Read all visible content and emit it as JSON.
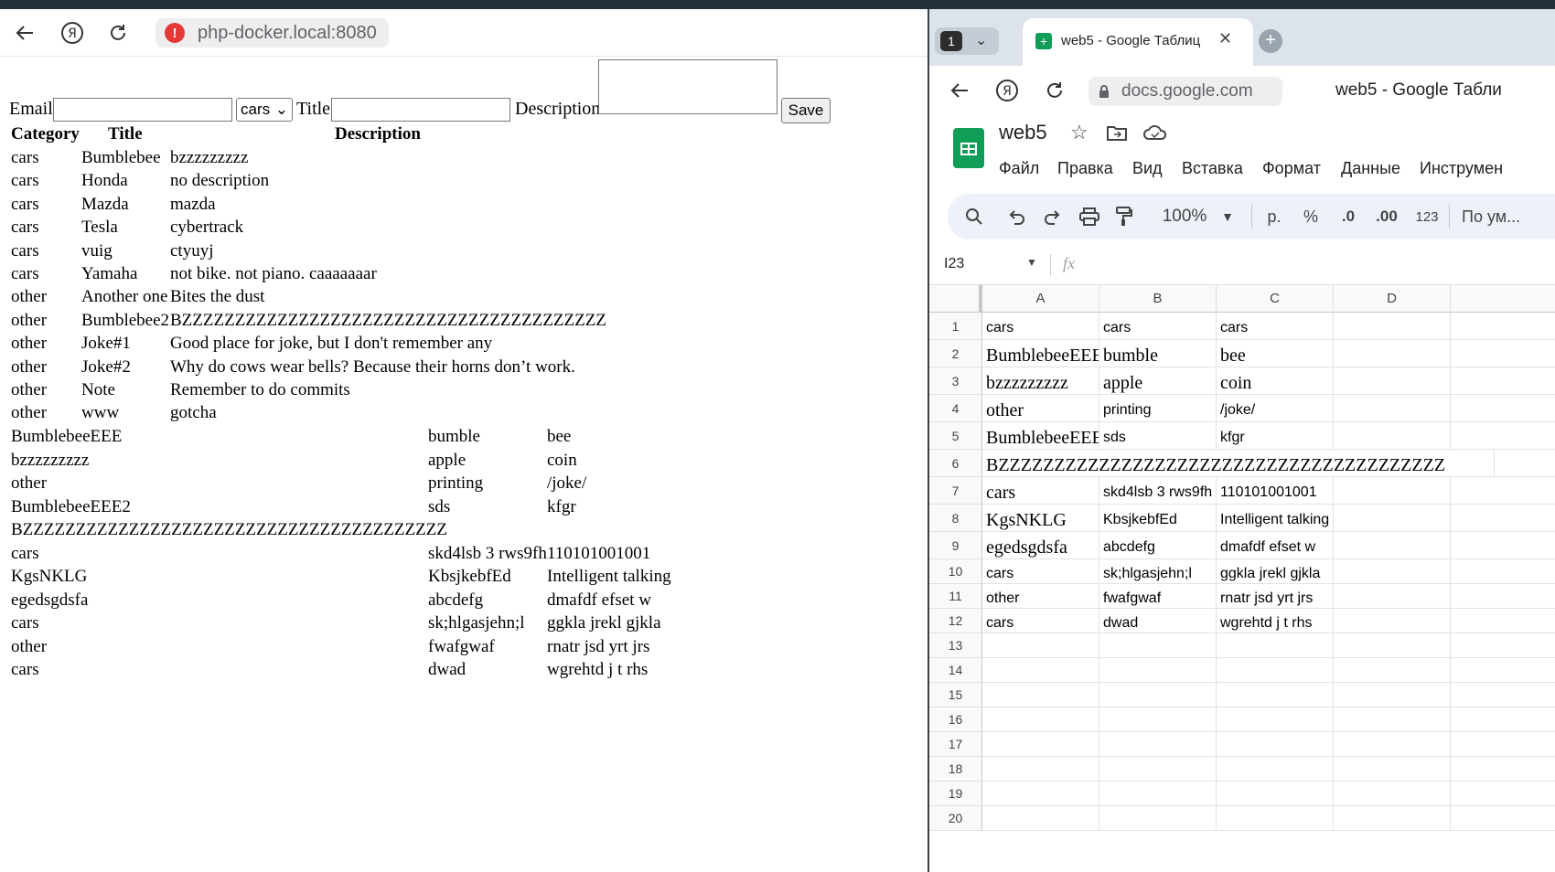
{
  "left_browser": {
    "address": "php-docker.local:8080"
  },
  "form": {
    "email_label": "Email",
    "category_selected": "cars",
    "title_label": "Title",
    "description_label": "Description",
    "save_label": "Save"
  },
  "table": {
    "headers": [
      "Category",
      "Title",
      "Description"
    ],
    "rows": [
      [
        "cars",
        "Bumblebee",
        "bzzzzzzzzz"
      ],
      [
        "cars",
        "Honda",
        "no description"
      ],
      [
        "cars",
        "Mazda",
        "mazda"
      ],
      [
        "cars",
        "Tesla",
        "cybertrack"
      ],
      [
        "cars",
        "vuig",
        "ctyuyj"
      ],
      [
        "cars",
        "Yamaha",
        "not bike. not piano. caaaaaaar"
      ],
      [
        "other",
        "Another one",
        "Bites the dust"
      ],
      [
        "other",
        "Bumblebee2",
        "BZZZZZZZZZZZZZZZZZZZZZZZZZZZZZZZZZZZZZZZZ"
      ],
      [
        "other",
        "Joke#1",
        "Good place for joke, but I don't remember any"
      ],
      [
        "other",
        "Joke#2",
        "Why do cows wear bells? Because their horns don’t work."
      ],
      [
        "other",
        "Note",
        "Remember to do commits"
      ],
      [
        "other",
        "www",
        "gotcha"
      ]
    ],
    "extra_rows": [
      [
        "BumblebeeEEE",
        "bumble",
        "bee"
      ],
      [
        "bzzzzzzzzz",
        "apple",
        "coin"
      ],
      [
        "other",
        "printing",
        "/joke/"
      ],
      [
        "BumblebeeEEE2",
        "sds",
        "kfgr"
      ],
      [
        "BZZZZZZZZZZZZZZZZZZZZZZZZZZZZZZZZZZZZZZZZ",
        "",
        ""
      ],
      [
        "cars",
        "skd4lsb 3 rws9fh",
        "110101001001"
      ],
      [
        "KgsNKLG",
        "KbsjkebfEd",
        "Intelligent talking"
      ],
      [
        "egedsgdsfa",
        "abcdefg",
        "dmafdf efset w"
      ],
      [
        "cars",
        "sk;hlgasjehn;l",
        "ggkla jrekl gjkla"
      ],
      [
        "other",
        "fwafgwaf",
        "rnatr jsd yrt jrs"
      ],
      [
        "cars",
        "dwad",
        "wgrehtd j t rhs"
      ]
    ]
  },
  "right_browser": {
    "tab_count": "1",
    "tab_title": "web5 - Google Таблиц",
    "address": "docs.google.com",
    "page_title": "web5 - Google Табли"
  },
  "sheets": {
    "doc_title": "web5",
    "menu": [
      "Файл",
      "Правка",
      "Вид",
      "Вставка",
      "Формат",
      "Данные",
      "Инструмен"
    ],
    "zoom": "100%",
    "currency": "р.",
    "percent": "%",
    "dec_less": ".0",
    "dec_more": ".00",
    "number_format": "123",
    "font_default": "По ум...",
    "cell_ref": "I23",
    "fx": "fx",
    "columns": [
      "A",
      "B",
      "C",
      "D"
    ],
    "rows": [
      {
        "n": "1",
        "a": "cars",
        "b": "cars",
        "c": "cars",
        "serif_a": false,
        "serif": false
      },
      {
        "n": "2",
        "a": "BumblebeeEEE",
        "b": "bumble",
        "c": "bee",
        "serif": true
      },
      {
        "n": "3",
        "a": "bzzzzzzzzz",
        "b": "apple",
        "c": "coin",
        "serif": true
      },
      {
        "n": "4",
        "a": "other",
        "b": "printing",
        "c": "/joke/",
        "serif": "a"
      },
      {
        "n": "5",
        "a": "BumblebeeEEE",
        "b": "sds",
        "c": "kfgr",
        "serif": "a"
      },
      {
        "n": "6",
        "a": "BZZZZZZZZZZZZZZZZZZZZZZZZZZZZZZZZZZZZZZZZ",
        "b": "",
        "c": "",
        "serif": true
      },
      {
        "n": "7",
        "a": "cars",
        "b": "skd4lsb 3 rws9fh",
        "c": "110101001001",
        "serif": "a"
      },
      {
        "n": "8",
        "a": "KgsNKLG",
        "b": "KbsjkebfEd",
        "c": "Intelligent talking",
        "serif": "a"
      },
      {
        "n": "9",
        "a": "egedsgdsfa",
        "b": "abcdefg",
        "c": "dmafdf efset w",
        "serif": "a"
      },
      {
        "n": "10",
        "a": "cars",
        "b": "sk;hlgasjehn;l",
        "c": "ggkla jrekl gjkla",
        "serif": false
      },
      {
        "n": "11",
        "a": "other",
        "b": "fwafgwaf",
        "c": "rnatr jsd yrt jrs",
        "serif": false
      },
      {
        "n": "12",
        "a": "cars",
        "b": "dwad",
        "c": "wgrehtd j t rhs",
        "serif": false
      },
      {
        "n": "13",
        "a": "",
        "b": "",
        "c": "",
        "serif": false
      },
      {
        "n": "14",
        "a": "",
        "b": "",
        "c": "",
        "serif": false
      },
      {
        "n": "15",
        "a": "",
        "b": "",
        "c": "",
        "serif": false
      },
      {
        "n": "16",
        "a": "",
        "b": "",
        "c": "",
        "serif": false
      },
      {
        "n": "17",
        "a": "",
        "b": "",
        "c": "",
        "serif": false
      },
      {
        "n": "18",
        "a": "",
        "b": "",
        "c": "",
        "serif": false
      },
      {
        "n": "19",
        "a": "",
        "b": "",
        "c": "",
        "serif": false
      },
      {
        "n": "20",
        "a": "",
        "b": "",
        "c": "",
        "serif": false
      }
    ]
  }
}
